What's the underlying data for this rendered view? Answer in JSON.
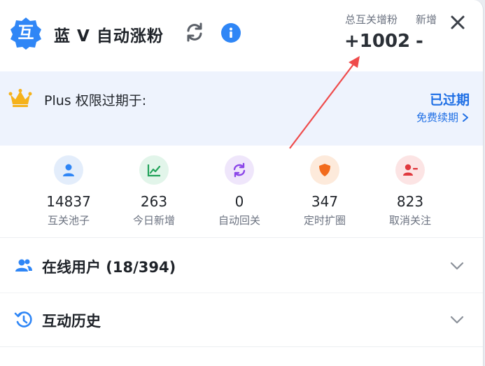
{
  "header": {
    "logo_text": "互",
    "title": "蓝 V 自动涨粉",
    "total_label": "总互关增粉",
    "new_label": "新增",
    "total_value": "+1002",
    "new_value": "-"
  },
  "plus": {
    "label": "Plus 权限过期于:",
    "status": "已过期",
    "renew_label": "免费续期"
  },
  "stats": [
    {
      "value": "14837",
      "label": "互关池子",
      "icon": "user-icon",
      "color": "#2f86f6",
      "bg": "#e3edfb"
    },
    {
      "value": "263",
      "label": "今日新增",
      "icon": "trend-chart-icon",
      "color": "#22a35a",
      "bg": "#e2f5ea"
    },
    {
      "value": "0",
      "label": "自动回关",
      "icon": "sync-icon",
      "color": "#8b46e8",
      "bg": "#efe6fb"
    },
    {
      "value": "347",
      "label": "定时扩圈",
      "icon": "shield-icon",
      "color": "#f26b1d",
      "bg": "#fdeadb"
    },
    {
      "value": "823",
      "label": "取消关注",
      "icon": "user-minus-icon",
      "color": "#e0393e",
      "bg": "#fce4e4"
    }
  ],
  "sections": {
    "online_label": "在线用户 (18/394)",
    "history_label": "互动历史"
  },
  "colors": {
    "accent": "#2f86f6",
    "link": "#1f6fe5",
    "banner_bg": "#eef3fd",
    "arrow": "#ef4b4b"
  }
}
